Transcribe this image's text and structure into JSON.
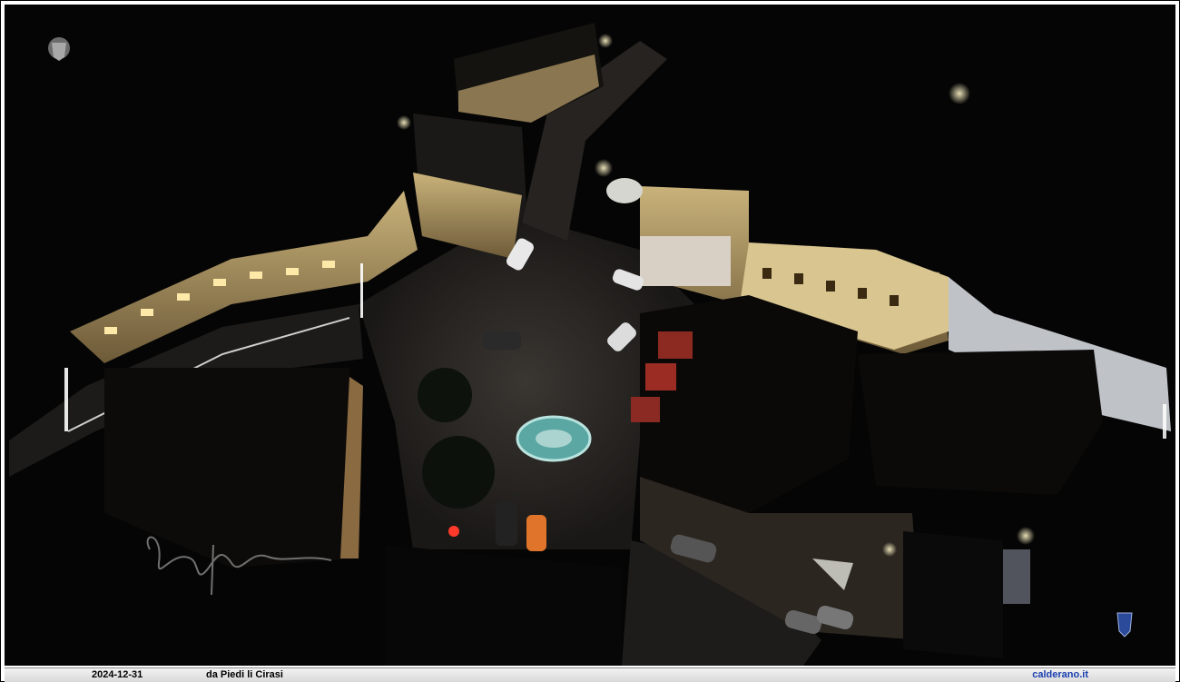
{
  "caption": {
    "date": "2024-12-31",
    "location": "da Piedi li Cirasi",
    "site": "calderano.it"
  },
  "photo": {
    "subject": "aerial-night-view-piazza",
    "icons": [
      "crest-emblem-icon",
      "small-crest-icon",
      "signature-watermark"
    ]
  },
  "colors": {
    "background": "#050505",
    "building_light": "#e8d49a",
    "fountain": "#5aa7a3",
    "caption_bar": "#e0e0e0",
    "site_link": "#1a3fb0"
  }
}
